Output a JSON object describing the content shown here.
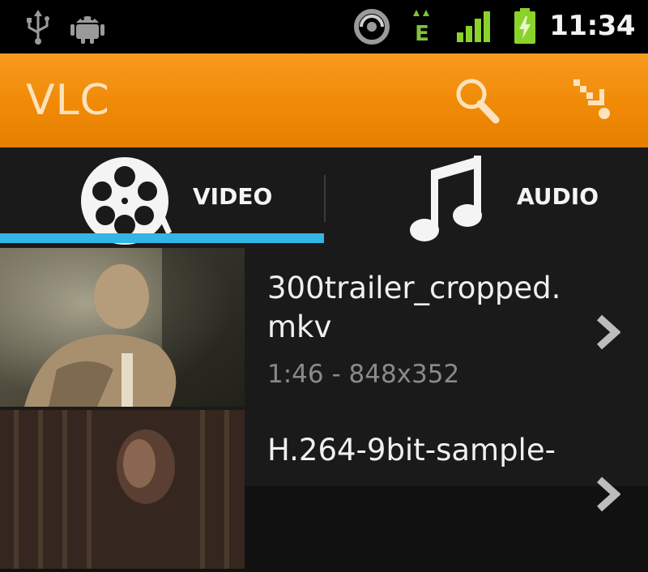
{
  "status_bar": {
    "time": "11:34",
    "icons": [
      "usb-icon",
      "android-debug-icon",
      "sync-icon",
      "data-signal-icon",
      "cell-signal-icon",
      "battery-icon"
    ],
    "data_type_label": "E"
  },
  "action_bar": {
    "title": "VLC",
    "actions": [
      "search-icon",
      "shuffle-direction-icon"
    ],
    "accent_color": "#f08a06"
  },
  "tabs": {
    "items": [
      {
        "label": "VIDEO",
        "icon": "film-reel-icon",
        "selected": true
      },
      {
        "label": "AUDIO",
        "icon": "music-note-icon",
        "selected": false
      }
    ],
    "indicator_color": "#33b5e5"
  },
  "media": {
    "items": [
      {
        "title": "300trailer_cropped.\nmkv",
        "info": "1:46 - 848x352"
      },
      {
        "title": "H.264-9bit-sample-",
        "info": ""
      }
    ]
  }
}
